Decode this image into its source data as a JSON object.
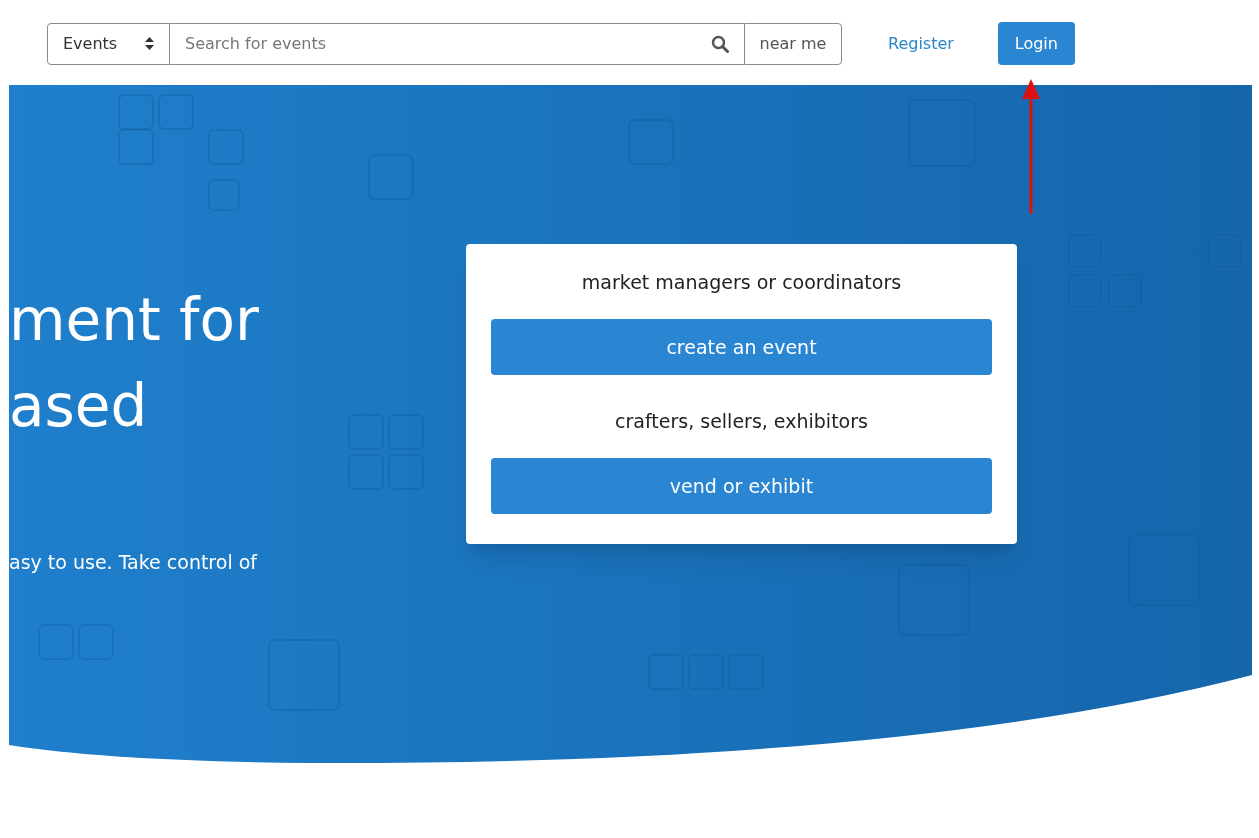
{
  "header": {
    "category_select": {
      "value": "Events"
    },
    "search": {
      "placeholder": "Search for events"
    },
    "location": {
      "value": "near me"
    },
    "register_link": "Register",
    "login_button": "Login"
  },
  "hero": {
    "heading_lines": [
      "ment for",
      "ased"
    ],
    "text": "asy to use. Take control of"
  },
  "card": {
    "groups": [
      {
        "label": "market managers or coordinators",
        "button": "create an event"
      },
      {
        "label": "crafters, sellers, exhibitors",
        "button": "vend or exhibit"
      }
    ]
  }
}
